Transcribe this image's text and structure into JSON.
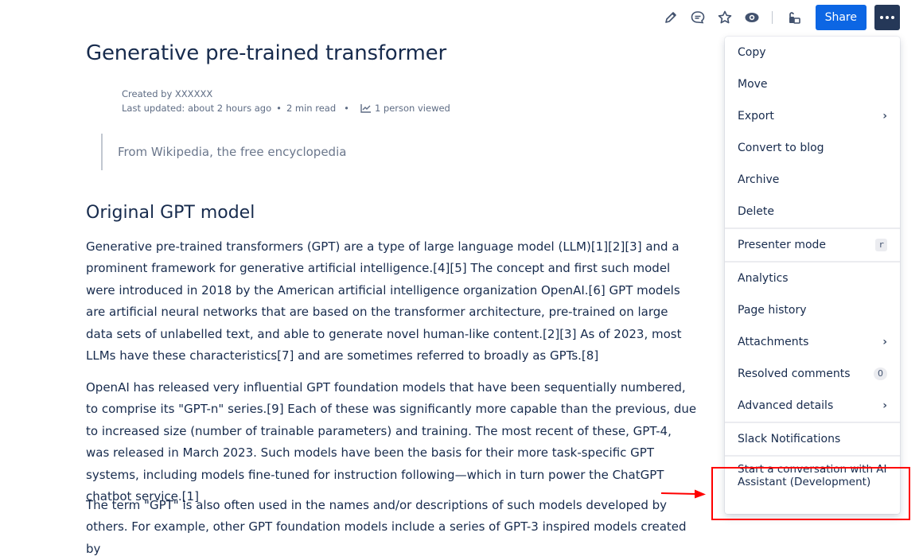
{
  "toolbar": {
    "icons": [
      "edit-icon",
      "comment-icon",
      "star-icon",
      "watch-icon",
      "restrictions-icon"
    ],
    "share_label": "Share",
    "more_icon": "more-icon"
  },
  "page": {
    "title": "Generative pre-trained transformer",
    "created_by": "Created by XXXXXX",
    "last_updated": "Last updated: about 2 hours ago",
    "read_time": "2 min read",
    "viewed": "1 person viewed",
    "quote": "From Wikipedia, the free encyclopedia",
    "section_heading": "Original GPT model",
    "paragraphs": [
      "Generative pre-trained transformers (GPT) are a type of large language model (LLM)[1][2][3] and a prominent framework for generative artificial intelligence.[4][5] The concept and first such model were introduced in 2018 by the American artificial intelligence organization OpenAI.[6] GPT models are artificial neural networks that are based on the transformer architecture, pre-trained on large data sets of unlabelled text, and able to generate novel human-like content.[2][3] As of 2023, most LLMs have these characteristics[7] and are sometimes referred to broadly as GPTs.[8]",
      "OpenAI has released very influential GPT foundation models that have been sequentially numbered, to comprise its \"GPT-n\" series.[9] Each of these was significantly more capable than the previous, due to increased size (number of trainable parameters) and training. The most recent of these, GPT-4, was released in March 2023. Such models have been the basis for their more task-specific GPT systems, including models fine-tuned for instruction following—which in turn power the ChatGPT chatbot service.[1]",
      "The term \"GPT\" is also often used in the names and/or descriptions of such models developed by others. For example, other GPT foundation models include a series of GPT-3 inspired models created by"
    ]
  },
  "menu": {
    "group1": [
      "Copy",
      "Move",
      "Export",
      "Convert to blog",
      "Archive",
      "Delete"
    ],
    "presenter": {
      "label": "Presenter mode",
      "shortcut": "r"
    },
    "group3": {
      "analytics": "Analytics",
      "page_history": "Page history",
      "attachments": "Attachments",
      "resolved_comments": "Resolved comments",
      "resolved_count": "0",
      "advanced_details": "Advanced details"
    },
    "slack": "Slack Notifications",
    "ai_assistant": "Start a conversation with AI Assistant (Development)"
  },
  "colors": {
    "primary": "#0c66e4",
    "more_button": "#253858",
    "annotation": "#ff0000"
  }
}
